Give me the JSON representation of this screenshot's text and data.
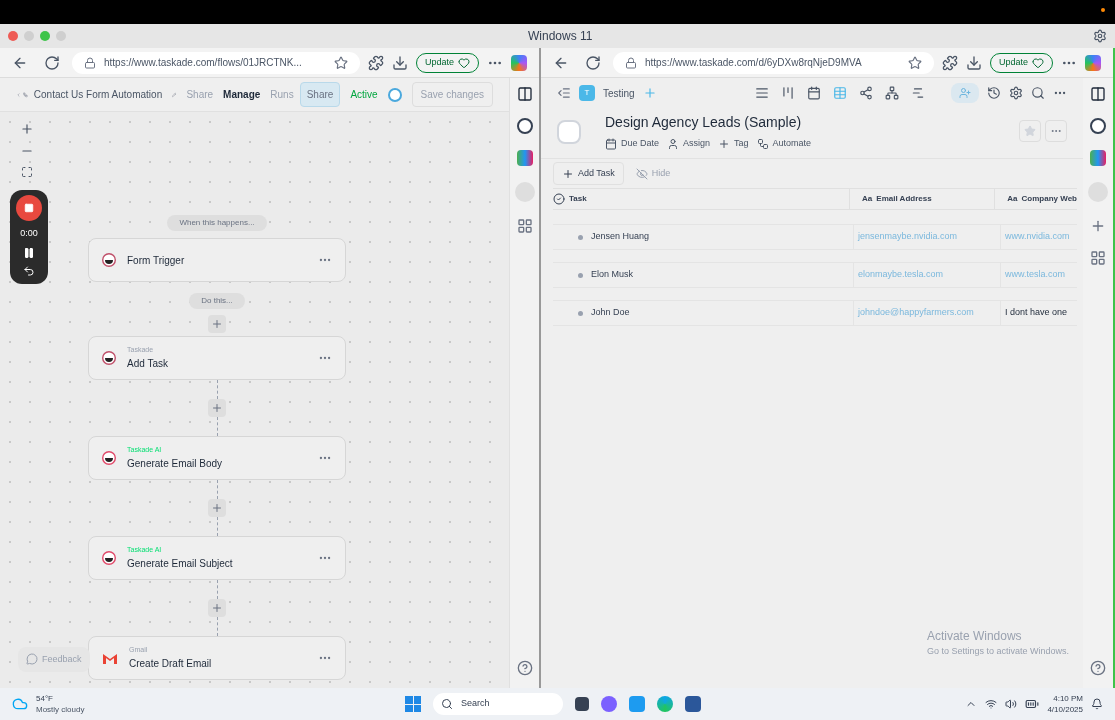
{
  "window": {
    "title": "Windows 11"
  },
  "left_browser": {
    "url": "https://www.taskade.com/flows/01JRCTNK...",
    "update_label": "Update"
  },
  "flow_header": {
    "title": "Contact Us Form Automation",
    "tabs": [
      {
        "label": "Share",
        "selected": false
      },
      {
        "label": "Manage",
        "selected": true
      },
      {
        "label": "Runs",
        "selected": false
      }
    ],
    "share_button": "Share",
    "active": {
      "label": "Active",
      "on": true
    },
    "save_button": "Save changes"
  },
  "recorder": {
    "time": "0:00"
  },
  "flow": {
    "trigger_label": "When this happens...",
    "action_label": "Do this...",
    "steps": [
      {
        "kind": "taskade",
        "title": "Form Trigger"
      },
      {
        "kind": "taskade",
        "app": "Taskade",
        "title": "Add Task"
      },
      {
        "kind": "taskade_ai",
        "app": "Taskade AI",
        "title": "Generate Email Body"
      },
      {
        "kind": "taskade_ai",
        "app": "Taskade AI",
        "title": "Generate Email Subject"
      },
      {
        "kind": "gmail",
        "app": "Gmail",
        "title": "Create Draft Email"
      }
    ]
  },
  "feedback_button": "Feedback",
  "right_browser": {
    "url": "https://www.taskade.com/d/6yDXw8rqNjeD9MVA",
    "update_label": "Update"
  },
  "workspace": {
    "initial": "T",
    "name": "Testing"
  },
  "project": {
    "title": "Design Agency Leads (Sample)",
    "actions": [
      "Due Date",
      "Assign",
      "Tag",
      "Automate"
    ]
  },
  "table_toolbar": {
    "add_task": "Add Task",
    "hide": "Hide"
  },
  "table": {
    "columns": [
      {
        "kind": "check",
        "label": "Task"
      },
      {
        "kind": "text",
        "type_label": "Aa",
        "label": "Email Address"
      },
      {
        "kind": "text",
        "type_label": "Aa",
        "label": "Company Web"
      }
    ],
    "rows": [
      [
        "Jensen Huang",
        "jensenmaybe.nvidia.com",
        "www.nvidia.com"
      ],
      [
        "Elon Musk",
        "elonmaybe.tesla.com",
        "www.tesla.com"
      ],
      [
        "John Doe",
        "johndoe@happyfarmers.com",
        "I dont have one"
      ]
    ]
  },
  "activation": {
    "title": "Activate Windows",
    "subtitle": "Go to Settings to activate Windows."
  },
  "taskbar": {
    "temperature": "54°F",
    "weather": "Mostly cloudy",
    "search": "Search",
    "time": "4:10 PM",
    "date": "4/10/2025"
  }
}
